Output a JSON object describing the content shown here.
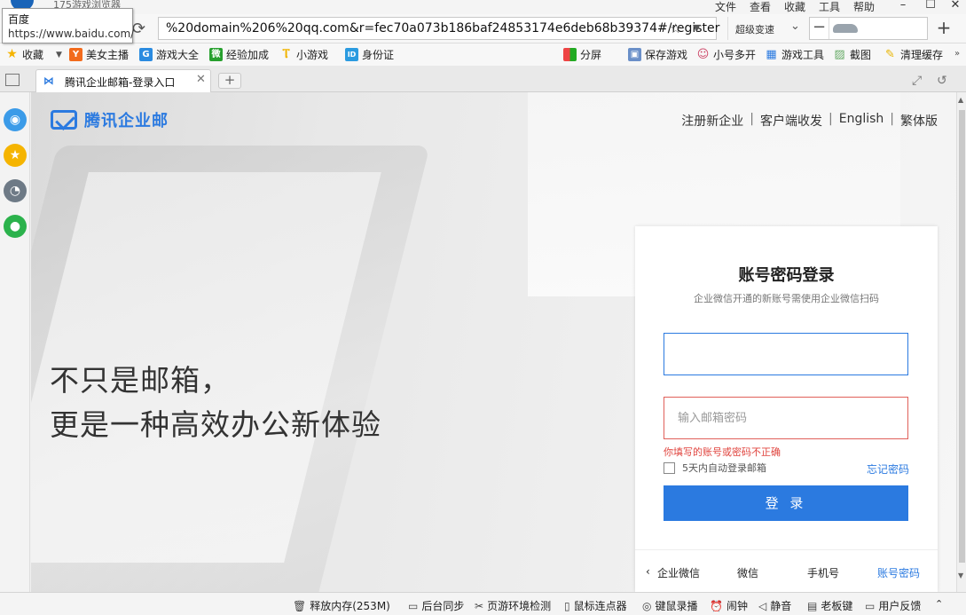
{
  "browser": {
    "app_title": "175游戏浏览器",
    "menus": [
      "文件",
      "查看",
      "收藏",
      "工具",
      "帮助"
    ],
    "url": "%20domain%206%20qq.com&r=fec70a073b186baf24853174e6deb68b39374#/register",
    "engine_label": "超级变速",
    "tooltip": {
      "title": "百度",
      "url": "https://www.baidu.com/"
    }
  },
  "bookmarks": {
    "left": [
      {
        "label": "收藏",
        "icon": "star-icon",
        "color": "#f5b400"
      },
      {
        "label": "美女主播",
        "icon": "y-icon",
        "color": "#f26b1d"
      },
      {
        "label": "游戏大全",
        "icon": "g-icon",
        "color": "#2b8be0"
      },
      {
        "label": "经验加成",
        "icon": "wei-icon",
        "color": "#27a02e"
      },
      {
        "label": "小游戏",
        "icon": "trophy-icon",
        "color": "#f0b400"
      },
      {
        "label": "身份证",
        "icon": "id-icon",
        "color": "#2b9be0"
      }
    ],
    "right": [
      {
        "label": "分屏",
        "icon": "windows-icon"
      },
      {
        "label": "保存游戏",
        "icon": "save-icon"
      },
      {
        "label": "小号多开",
        "icon": "users-icon"
      },
      {
        "label": "游戏工具",
        "icon": "gamepad-icon"
      },
      {
        "label": "截图",
        "icon": "screenshot-icon"
      },
      {
        "label": "清理缓存",
        "icon": "broom-icon"
      }
    ]
  },
  "tab": {
    "title": "腾讯企业邮箱-登录入口"
  },
  "page": {
    "brand": "腾讯企业邮",
    "links": [
      "注册新企业",
      "客户端收发",
      "English",
      "繁体版"
    ],
    "slogan_line1": "不只是邮箱，",
    "slogan_line2": "更是一种高效办公新体验",
    "login": {
      "title": "账号密码登录",
      "subtitle": "企业微信开通的新账号需使用企业微信扫码",
      "username_value": "",
      "password_placeholder": "输入邮箱密码",
      "error": "你填写的账号或密码不正确",
      "remember": "5天内自动登录邮箱",
      "forgot": "忘记密码",
      "submit": "登 录",
      "tabs": [
        "企业微信",
        "微信",
        "手机号",
        "账号密码"
      ],
      "active_tab": "账号密码"
    }
  },
  "statusbar": [
    {
      "label": "释放内存(253M)",
      "icon": "trash-icon"
    },
    {
      "label": "后台同步",
      "icon": "window-icon"
    },
    {
      "label": "页游环境检测",
      "icon": "tools-icon"
    },
    {
      "label": "鼠标连点器",
      "icon": "mouse-icon"
    },
    {
      "label": "键鼠录播",
      "icon": "record-icon"
    },
    {
      "label": "闹钟",
      "icon": "alarm-icon"
    },
    {
      "label": "静音",
      "icon": "speaker-icon"
    },
    {
      "label": "老板键",
      "icon": "boss-key-icon"
    },
    {
      "label": "用户反馈",
      "icon": "feedback-icon"
    }
  ],
  "colors": {
    "accent": "#2b7ae0",
    "error": "#e0443e"
  }
}
